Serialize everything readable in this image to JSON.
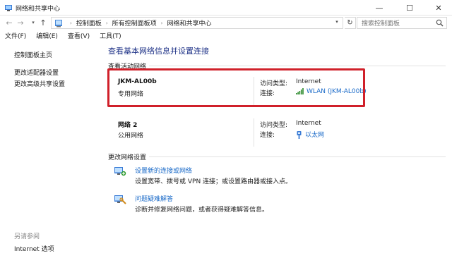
{
  "window": {
    "title": "网络和共享中心",
    "minimize_glyph": "—",
    "maximize_glyph": "☐",
    "close_glyph": "✕"
  },
  "address_bar": {
    "crumbs": [
      "控制面板",
      "所有控制面板项",
      "网络和共享中心"
    ],
    "search_placeholder": "搜索控制面板"
  },
  "menu": [
    "文件(F)",
    "编辑(E)",
    "查看(V)",
    "工具(T)"
  ],
  "left_pane": {
    "links": [
      "控制面板主页",
      "更改适配器设置",
      "更改高级共享设置"
    ],
    "see_also_title": "另请参阅",
    "see_also_links": [
      "Internet 选项"
    ]
  },
  "main": {
    "heading": "查看基本网络信息并设置连接",
    "active_networks_label": "查看活动网络",
    "networks": [
      {
        "name": "JKM-AL00b",
        "type": "专用网络",
        "access_label": "访问类型:",
        "access_value": "Internet",
        "conn_label": "连接:",
        "conn_value": "WLAN (JKM-AL00b)",
        "conn_icon": "wifi-signal-icon",
        "highlighted": true
      },
      {
        "name": "网络 2",
        "type": "公用网络",
        "access_label": "访问类型:",
        "access_value": "Internet",
        "conn_label": "连接:",
        "conn_value": "以太网",
        "conn_icon": "ethernet-icon",
        "highlighted": false
      }
    ],
    "change_settings_label": "更改网络设置",
    "tasks": [
      {
        "link": "设置新的连接或网络",
        "desc": "设置宽带、拨号或 VPN 连接；或设置路由器或接入点。",
        "icon": "new-connection-icon"
      },
      {
        "link": "问题疑难解答",
        "desc": "诊断并修复网络问题，或者获得疑难解答信息。",
        "icon": "troubleshoot-icon"
      }
    ]
  },
  "colors": {
    "link": "#1a6ac8",
    "heading": "#1e3287",
    "highlight_box": "#d0202a"
  }
}
